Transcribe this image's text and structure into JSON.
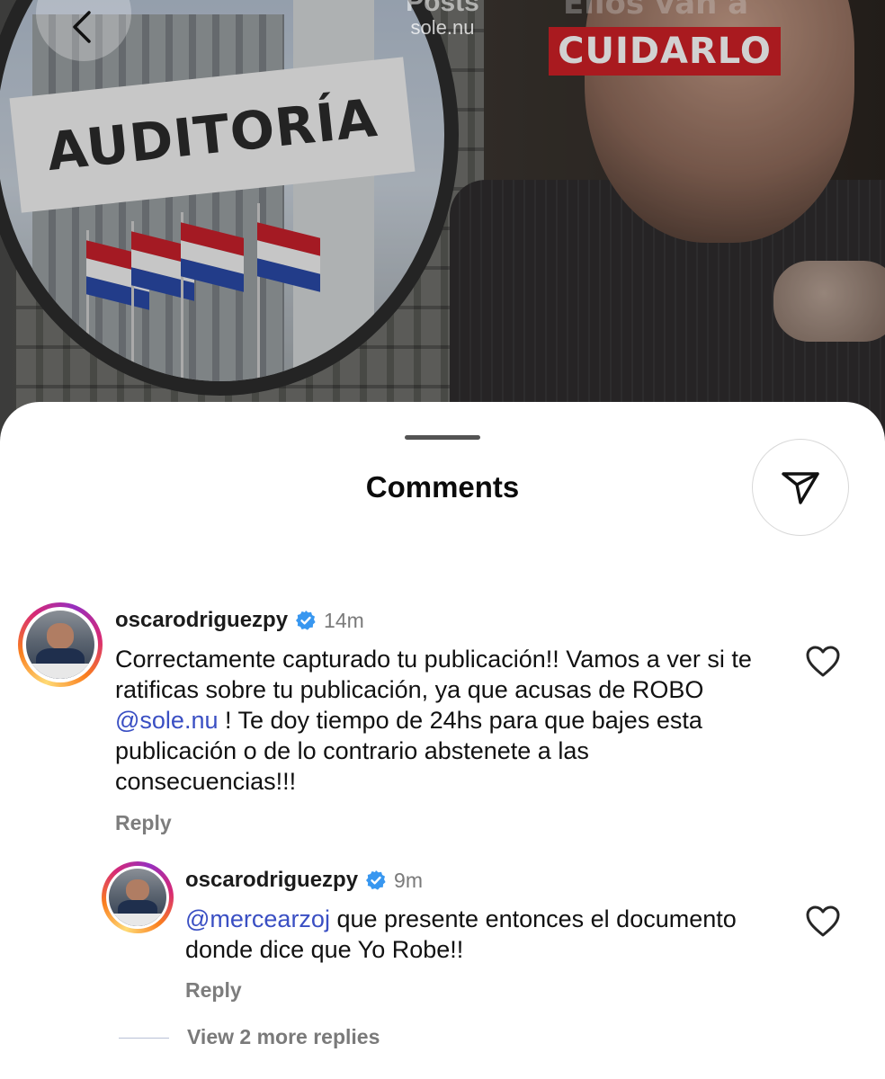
{
  "header": {
    "title": "Posts",
    "subtitle": "sole.nu",
    "back_icon": "chevron-left-icon"
  },
  "post_image": {
    "overlay_top_text": "Ellos van a",
    "overlay_banner": "CUIDARLO",
    "sign_text": "AUDITORÍA",
    "banner_color": "#cf2026"
  },
  "sheet": {
    "title": "Comments",
    "share_icon": "send-icon"
  },
  "comments": [
    {
      "username": "oscarodriguezpy",
      "verified": true,
      "time": "14m",
      "text_before": "Correctamente capturado tu publicación!! Vamos a ver si te ratificas sobre tu publicación, ya que acusas de ROBO ",
      "mention": "@sole.nu",
      "text_after": " ! Te doy tiempo de 24hs para que bajes esta publicación o de lo contrario abstenete a las consecuencias!!!",
      "reply_label": "Reply"
    },
    {
      "username": "oscarodriguezpy",
      "verified": true,
      "time": "9m",
      "mention": "@mercearzoj",
      "text_after": " que presente entonces el documento donde dice que Yo Robe!!",
      "reply_label": "Reply"
    }
  ],
  "view_more_replies": "View 2 more replies",
  "colors": {
    "mention": "#3a4fc3",
    "verified": "#3897f0",
    "muted": "#7a7a7a"
  }
}
